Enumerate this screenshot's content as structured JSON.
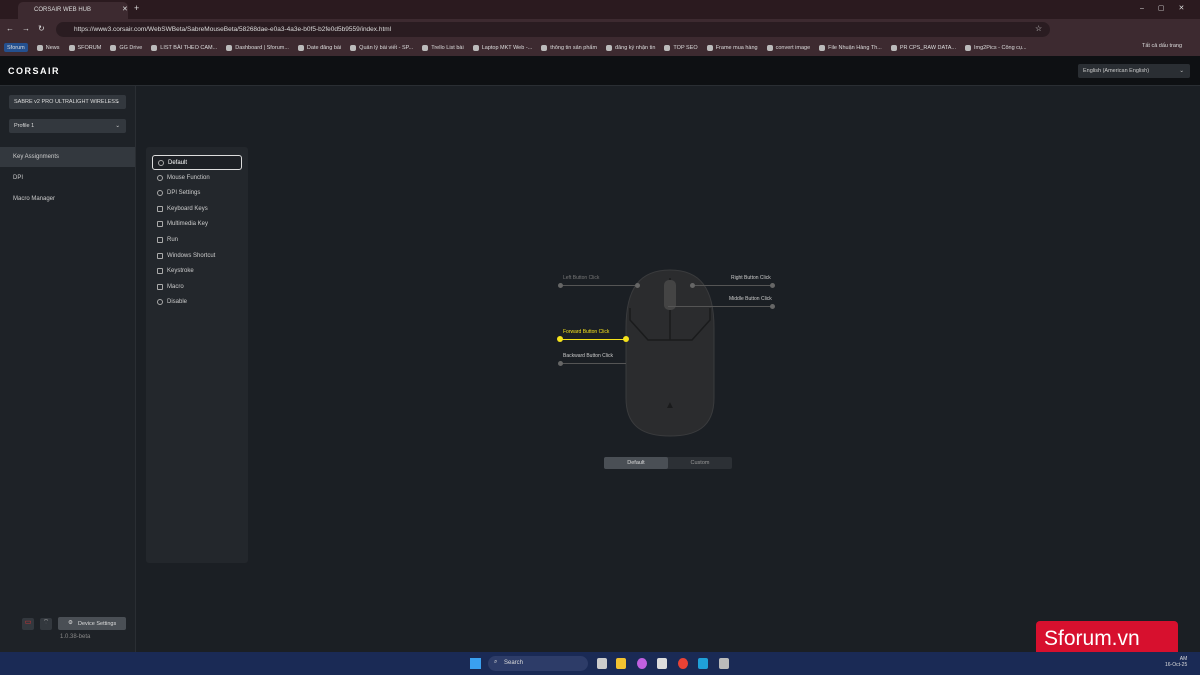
{
  "browser": {
    "tab_title": "CORSAIR WEB HUB",
    "url": "https://www3.corsair.com/WebSWBeta/SabreMouseBeta/58268dae-e0a3-4a3e-b0f5-b2fe0d5b9559/index.html",
    "bookmarks": [
      "Sforum",
      "News",
      "SFORUM",
      "GG Drive",
      "LIST BÀI THEO CAM...",
      "Dashboard | Sforum...",
      "Date đăng bài",
      "Quản lý bài viết - SP...",
      "Trello List bài",
      "Laptop MKT Web -...",
      "thông tin sản phẩm",
      "đăng ký nhận tin",
      "TOP SEO",
      "Frame mua hàng",
      "convert image",
      "File Nhuận Hàng Th...",
      "PR CPS_RAW DATA...",
      "Img2Pics - Công cụ..."
    ],
    "all_bookmarks": "Tất cả dấu trang"
  },
  "app": {
    "brand": "CORSAIR",
    "language": "English (American English)",
    "device": "SABRE v2 PRO ULTRALIGHT WIRELESS",
    "profile": "Profile 1",
    "nav": [
      "Key Assignments",
      "DPI",
      "Macro Manager"
    ],
    "menu": [
      "Default",
      "Mouse Function",
      "DPI Settings",
      "Keyboard Keys",
      "Multimedia Key",
      "Run",
      "Windows Shortcut",
      "Keystroke",
      "Macro",
      "Disable"
    ],
    "buttons": {
      "left": "Left Button Click",
      "right": "Right Button Click",
      "middle": "Middle Button Click",
      "forward": "Forward Button Click",
      "backward": "Backward Button Click"
    },
    "toggle": [
      "Default",
      "Custom"
    ],
    "device_settings": "Device Settings",
    "version": "1.0.38-beta"
  },
  "taskbar": {
    "search": "Search",
    "date": "16-Oct-25",
    "time": "AM"
  },
  "watermark": "Sforum.vn",
  "colors": {
    "highlight": "#f5e21b",
    "watermark": "#d7102e"
  }
}
